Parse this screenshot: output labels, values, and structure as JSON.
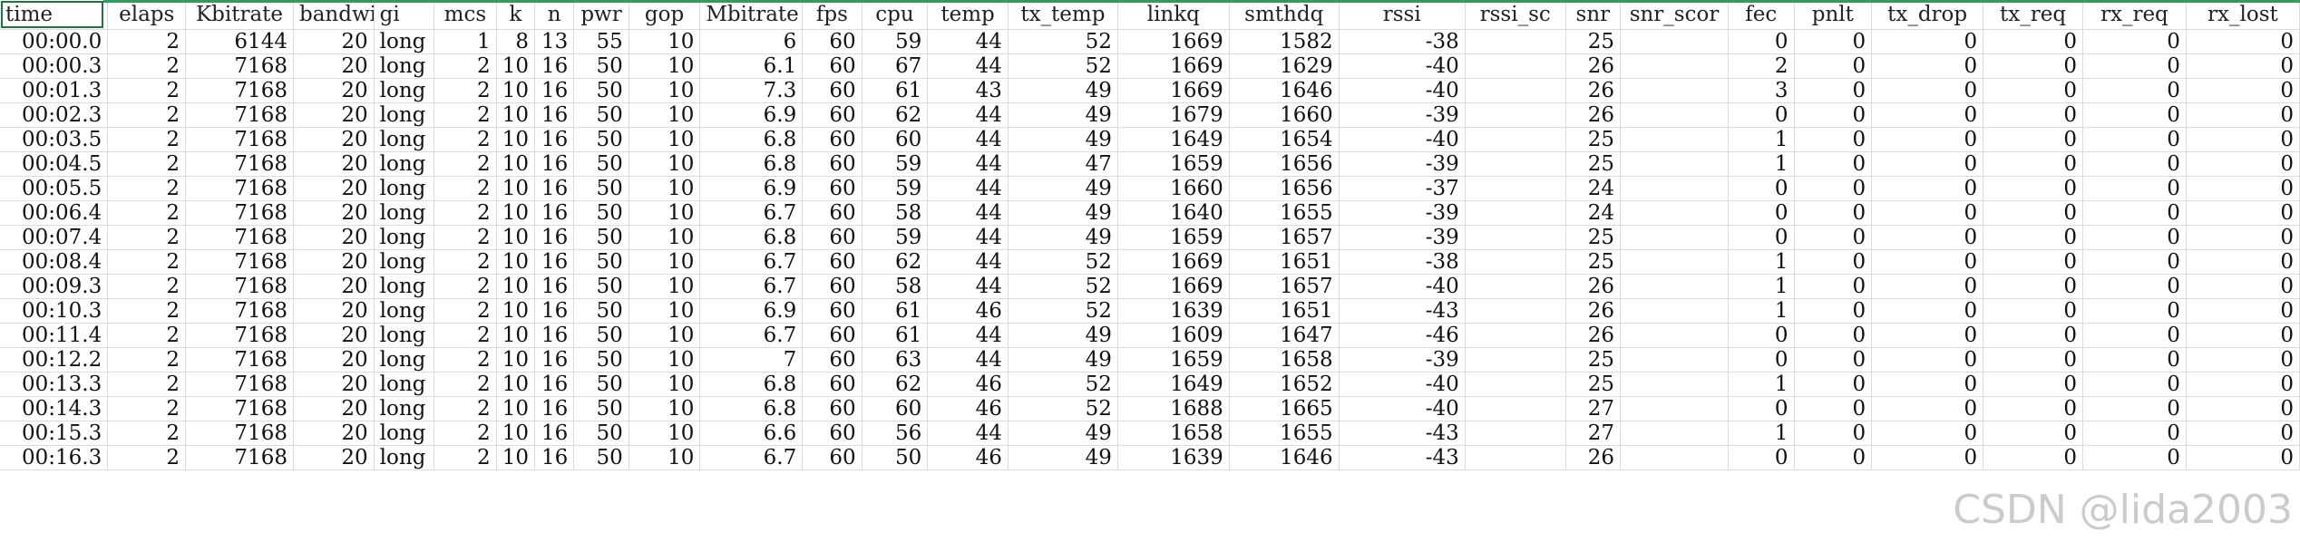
{
  "columns": [
    "time",
    "elaps",
    "Kbitrate",
    "bandwi",
    "gi",
    "mcs",
    "k",
    "n",
    "pwr",
    "gop",
    "Mbitrate",
    "fps",
    "cpu",
    "temp",
    "tx_temp",
    "linkq",
    "smthdq",
    "rssi",
    "rssi_sc",
    "snr",
    "snr_scor",
    "fec",
    "pnlt",
    "tx_drop",
    "tx_req",
    "rx_req",
    "rx_lost"
  ],
  "rows": [
    [
      "00:00.0",
      "2",
      "6144",
      "20",
      "long",
      "1",
      "8",
      "13",
      "55",
      "10",
      "6",
      "60",
      "59",
      "44",
      "52",
      "1669",
      "1582",
      "-38",
      "",
      "25",
      "",
      "0",
      "0",
      "0",
      "0",
      "0",
      "0"
    ],
    [
      "00:00.3",
      "2",
      "7168",
      "20",
      "long",
      "2",
      "10",
      "16",
      "50",
      "10",
      "6.1",
      "60",
      "67",
      "44",
      "52",
      "1669",
      "1629",
      "-40",
      "",
      "26",
      "",
      "2",
      "0",
      "0",
      "0",
      "0",
      "0"
    ],
    [
      "00:01.3",
      "2",
      "7168",
      "20",
      "long",
      "2",
      "10",
      "16",
      "50",
      "10",
      "7.3",
      "60",
      "61",
      "43",
      "49",
      "1669",
      "1646",
      "-40",
      "",
      "26",
      "",
      "3",
      "0",
      "0",
      "0",
      "0",
      "0"
    ],
    [
      "00:02.3",
      "2",
      "7168",
      "20",
      "long",
      "2",
      "10",
      "16",
      "50",
      "10",
      "6.9",
      "60",
      "62",
      "44",
      "49",
      "1679",
      "1660",
      "-39",
      "",
      "26",
      "",
      "0",
      "0",
      "0",
      "0",
      "0",
      "0"
    ],
    [
      "00:03.5",
      "2",
      "7168",
      "20",
      "long",
      "2",
      "10",
      "16",
      "50",
      "10",
      "6.8",
      "60",
      "60",
      "44",
      "49",
      "1649",
      "1654",
      "-40",
      "",
      "25",
      "",
      "1",
      "0",
      "0",
      "0",
      "0",
      "0"
    ],
    [
      "00:04.5",
      "2",
      "7168",
      "20",
      "long",
      "2",
      "10",
      "16",
      "50",
      "10",
      "6.8",
      "60",
      "59",
      "44",
      "47",
      "1659",
      "1656",
      "-39",
      "",
      "25",
      "",
      "1",
      "0",
      "0",
      "0",
      "0",
      "0"
    ],
    [
      "00:05.5",
      "2",
      "7168",
      "20",
      "long",
      "2",
      "10",
      "16",
      "50",
      "10",
      "6.9",
      "60",
      "59",
      "44",
      "49",
      "1660",
      "1656",
      "-37",
      "",
      "24",
      "",
      "0",
      "0",
      "0",
      "0",
      "0",
      "0"
    ],
    [
      "00:06.4",
      "2",
      "7168",
      "20",
      "long",
      "2",
      "10",
      "16",
      "50",
      "10",
      "6.7",
      "60",
      "58",
      "44",
      "49",
      "1640",
      "1655",
      "-39",
      "",
      "24",
      "",
      "0",
      "0",
      "0",
      "0",
      "0",
      "0"
    ],
    [
      "00:07.4",
      "2",
      "7168",
      "20",
      "long",
      "2",
      "10",
      "16",
      "50",
      "10",
      "6.8",
      "60",
      "59",
      "44",
      "49",
      "1659",
      "1657",
      "-39",
      "",
      "25",
      "",
      "0",
      "0",
      "0",
      "0",
      "0",
      "0"
    ],
    [
      "00:08.4",
      "2",
      "7168",
      "20",
      "long",
      "2",
      "10",
      "16",
      "50",
      "10",
      "6.7",
      "60",
      "62",
      "44",
      "52",
      "1669",
      "1651",
      "-38",
      "",
      "25",
      "",
      "1",
      "0",
      "0",
      "0",
      "0",
      "0"
    ],
    [
      "00:09.3",
      "2",
      "7168",
      "20",
      "long",
      "2",
      "10",
      "16",
      "50",
      "10",
      "6.7",
      "60",
      "58",
      "44",
      "52",
      "1669",
      "1657",
      "-40",
      "",
      "26",
      "",
      "1",
      "0",
      "0",
      "0",
      "0",
      "0"
    ],
    [
      "00:10.3",
      "2",
      "7168",
      "20",
      "long",
      "2",
      "10",
      "16",
      "50",
      "10",
      "6.9",
      "60",
      "61",
      "46",
      "52",
      "1639",
      "1651",
      "-43",
      "",
      "26",
      "",
      "1",
      "0",
      "0",
      "0",
      "0",
      "0"
    ],
    [
      "00:11.4",
      "2",
      "7168",
      "20",
      "long",
      "2",
      "10",
      "16",
      "50",
      "10",
      "6.7",
      "60",
      "61",
      "44",
      "49",
      "1609",
      "1647",
      "-46",
      "",
      "26",
      "",
      "0",
      "0",
      "0",
      "0",
      "0",
      "0"
    ],
    [
      "00:12.2",
      "2",
      "7168",
      "20",
      "long",
      "2",
      "10",
      "16",
      "50",
      "10",
      "7",
      "60",
      "63",
      "44",
      "49",
      "1659",
      "1658",
      "-39",
      "",
      "25",
      "",
      "0",
      "0",
      "0",
      "0",
      "0",
      "0"
    ],
    [
      "00:13.3",
      "2",
      "7168",
      "20",
      "long",
      "2",
      "10",
      "16",
      "50",
      "10",
      "6.8",
      "60",
      "62",
      "46",
      "52",
      "1649",
      "1652",
      "-40",
      "",
      "25",
      "",
      "1",
      "0",
      "0",
      "0",
      "0",
      "0"
    ],
    [
      "00:14.3",
      "2",
      "7168",
      "20",
      "long",
      "2",
      "10",
      "16",
      "50",
      "10",
      "6.8",
      "60",
      "60",
      "46",
      "52",
      "1688",
      "1665",
      "-40",
      "",
      "27",
      "",
      "0",
      "0",
      "0",
      "0",
      "0",
      "0"
    ],
    [
      "00:15.3",
      "2",
      "7168",
      "20",
      "long",
      "2",
      "10",
      "16",
      "50",
      "10",
      "6.6",
      "60",
      "56",
      "44",
      "49",
      "1658",
      "1655",
      "-43",
      "",
      "27",
      "",
      "1",
      "0",
      "0",
      "0",
      "0",
      "0"
    ],
    [
      "00:16.3",
      "2",
      "7168",
      "20",
      "long",
      "2",
      "10",
      "16",
      "50",
      "10",
      "6.7",
      "60",
      "50",
      "46",
      "49",
      "1639",
      "1646",
      "-43",
      "",
      "26",
      "",
      "0",
      "0",
      "0",
      "0",
      "0",
      "0"
    ]
  ],
  "watermark": "CSDN @lida2003",
  "colors": {
    "selection": "#217346",
    "gridline": "#dcdcdc"
  }
}
